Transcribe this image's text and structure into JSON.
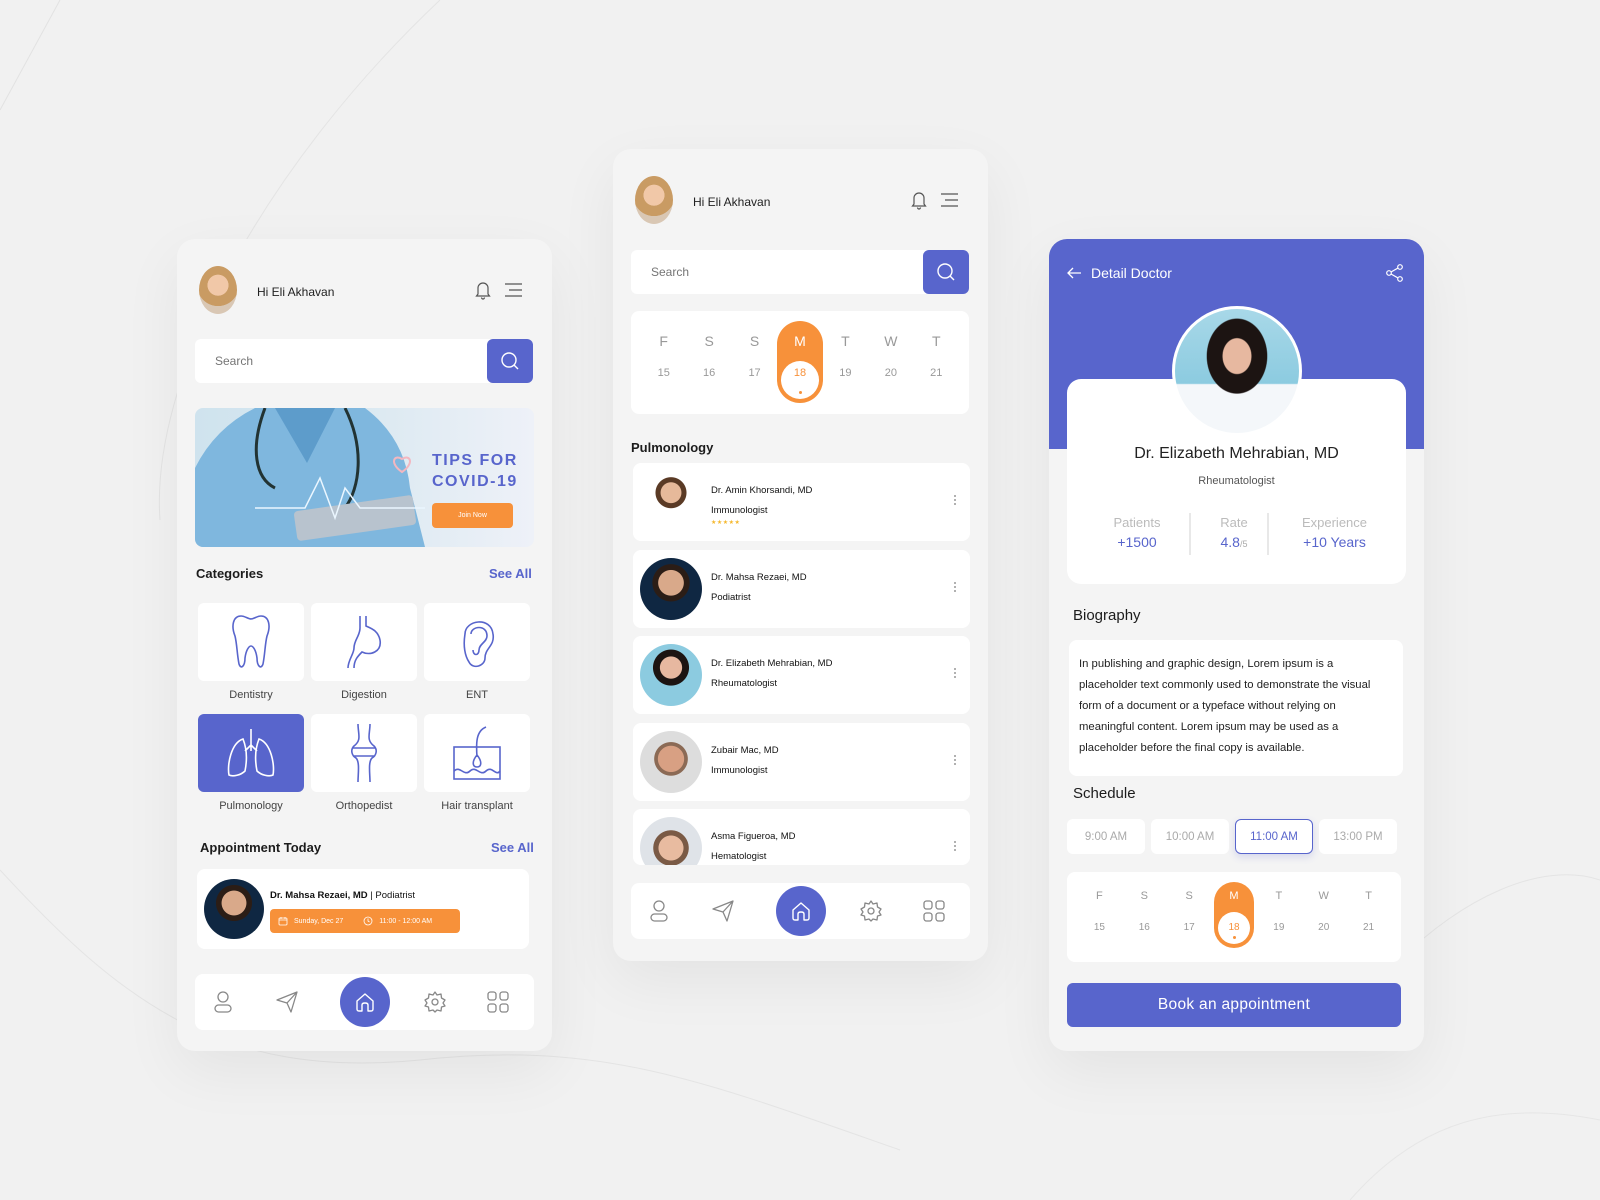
{
  "colors": {
    "accent": "#5865cc",
    "orange": "#f7913a",
    "background": "#f1f1f1",
    "star": "#f5b82e"
  },
  "screens": {
    "home": {
      "greeting": "Hi Eli Akhavan",
      "icons": {
        "notification": "bell-icon",
        "menu": "hamburger-menu-icon",
        "search": "search-icon"
      },
      "search": {
        "placeholder": "Search",
        "value": ""
      },
      "banner": {
        "title": "TIPS FOR COVID-19",
        "button_label": "Join Now",
        "decoration": "heart-icon"
      },
      "categories": {
        "title": "Categories",
        "see_all": "See All",
        "items": [
          {
            "label": "Dentistry",
            "icon": "tooth-icon",
            "active": false
          },
          {
            "label": "Digestion",
            "icon": "stomach-icon",
            "active": false
          },
          {
            "label": "ENT",
            "icon": "ear-icon",
            "active": false
          },
          {
            "label": "Pulmonology",
            "icon": "lungs-icon",
            "active": true
          },
          {
            "label": "Orthopedist",
            "icon": "knee-joint-icon",
            "active": false
          },
          {
            "label": "Hair transplant",
            "icon": "hair-follicle-icon",
            "active": false
          }
        ]
      },
      "appointment": {
        "title": "Appointment Today",
        "see_all": "See All",
        "doctor": "Dr. Mahsa Rezaei, MD",
        "separator": "|",
        "specialty": "Podiatrist",
        "date": "Sunday, Dec 27",
        "time": "11:00 - 12:00 AM"
      },
      "nav": [
        "profile-icon",
        "send-icon",
        "home-icon",
        "settings-icon",
        "grid-icon"
      ]
    },
    "list": {
      "greeting": "Hi Eli Akhavan",
      "search": {
        "placeholder": "Search",
        "value": ""
      },
      "calendar": {
        "days": [
          {
            "day": "F",
            "date": "15"
          },
          {
            "day": "S",
            "date": "16"
          },
          {
            "day": "S",
            "date": "17"
          },
          {
            "day": "M",
            "date": "18",
            "selected": true
          },
          {
            "day": "T",
            "date": "19"
          },
          {
            "day": "W",
            "date": "20"
          },
          {
            "day": "T",
            "date": "21"
          }
        ]
      },
      "section_title": "Pulmonology",
      "doctors": [
        {
          "name": "Dr. Amin Khorsandi, MD",
          "specialty": "Immunologist",
          "rating_stars": 5
        },
        {
          "name": "Dr. Mahsa Rezaei, MD",
          "specialty": "Podiatrist"
        },
        {
          "name": "Dr. Elizabeth Mehrabian, MD",
          "specialty": "Rheumatologist"
        },
        {
          "name": "Zubair Mac, MD",
          "specialty": "Immunologist"
        },
        {
          "name": "Asma Figueroa, MD",
          "specialty": "Hematologist"
        }
      ],
      "stars_text": "★★★★★"
    },
    "detail": {
      "title": "Detail Doctor",
      "back_icon": "arrow-left-icon",
      "share_icon": "share-icon",
      "doctor_name": "Dr. Elizabeth Mehrabian, MD",
      "specialty": "Rheumatologist",
      "stats": [
        {
          "label": "Patients",
          "value": "+1500",
          "suffix": ""
        },
        {
          "label": "Rate",
          "value": "4.8",
          "suffix": "/5"
        },
        {
          "label": "Experience",
          "value": "+10 Years",
          "suffix": ""
        }
      ],
      "biography_title": "Biography",
      "biography": "In publishing and graphic design, Lorem ipsum is a placeholder text commonly used to demonstrate the visual form of a document or a typeface without relying on meaningful content. Lorem ipsum may be used as a placeholder before the final copy is available.",
      "schedule_title": "Schedule",
      "time_slots": [
        {
          "label": "9:00 AM",
          "selected": false
        },
        {
          "label": "10:00 AM",
          "selected": false
        },
        {
          "label": "11:00 AM",
          "selected": true
        },
        {
          "label": "13:00 PM",
          "selected": false
        }
      ],
      "calendar": {
        "days": [
          {
            "day": "F",
            "date": "15"
          },
          {
            "day": "S",
            "date": "16"
          },
          {
            "day": "S",
            "date": "17"
          },
          {
            "day": "M",
            "date": "18",
            "selected": true
          },
          {
            "day": "T",
            "date": "19"
          },
          {
            "day": "W",
            "date": "20"
          },
          {
            "day": "T",
            "date": "21"
          }
        ]
      },
      "book_button": "Book an appointment"
    }
  }
}
